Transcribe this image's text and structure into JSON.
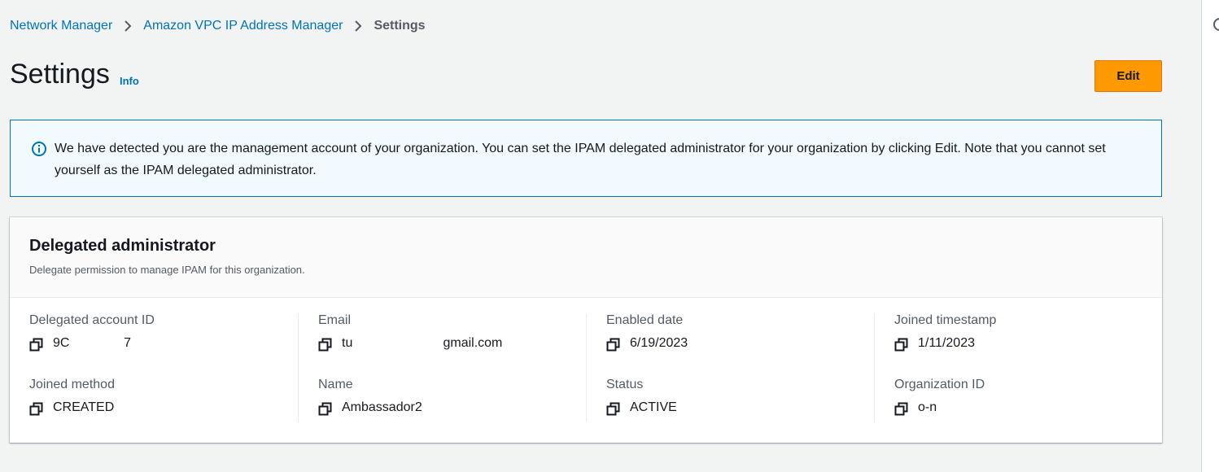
{
  "breadcrumb": {
    "items": [
      "Network Manager",
      "Amazon VPC IP Address Manager"
    ],
    "current": "Settings"
  },
  "header": {
    "title": "Settings",
    "info_label": "Info",
    "edit_label": "Edit"
  },
  "alert": {
    "icon": "info-icon",
    "text": "We have detected you are the management account of your organization. You can set the IPAM delegated administrator for your organization by clicking Edit. Note that you cannot set yourself as the IPAM delegated administrator."
  },
  "panel": {
    "title": "Delegated administrator",
    "description": "Delegate permission to manage IPAM for this organization.",
    "fields": [
      {
        "label": "Delegated account ID",
        "value": "9C               7"
      },
      {
        "label": "Joined method",
        "value": "CREATED"
      },
      {
        "label": "Email",
        "value": "tu                         gmail.com"
      },
      {
        "label": "Name",
        "value": "Ambassador2"
      },
      {
        "label": "Enabled date",
        "value": "6/19/2023"
      },
      {
        "label": "Status",
        "value": "ACTIVE"
      },
      {
        "label": "Joined timestamp",
        "value": "1/11/2023"
      },
      {
        "label": "Organization ID",
        "value": "o-n"
      }
    ]
  },
  "colors": {
    "link": "#0073bb",
    "primary_button": "#ff9900",
    "alert_background": "#f1faff",
    "alert_border": "#0073bb",
    "page_background": "#f2f3f3"
  }
}
